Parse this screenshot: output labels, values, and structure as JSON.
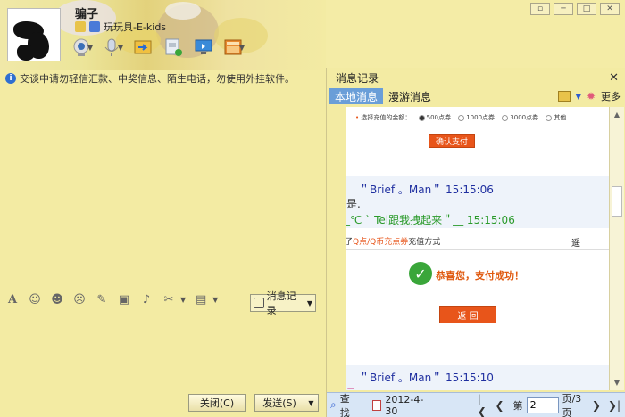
{
  "header": {
    "nickname": "骗子",
    "status_text": "玩玩具-E-kids"
  },
  "notice": "交谈中请勿轻信汇款、中奖信息、陌生电话，勿使用外挂软件。",
  "input": {
    "history_button_label": "消息记录",
    "close_button_label": "关闭(C)",
    "send_button_label": "发送(S)"
  },
  "history_panel": {
    "title": "消息记录",
    "tabs": [
      {
        "label": "本地消息",
        "active": true
      },
      {
        "label": "漫游消息",
        "active": false
      }
    ],
    "more_label": "更多",
    "messages": [
      {
        "header": "＂Brief 。Man＂ 15:15:06",
        "text": "是."
      },
      {
        "header": "__℃ ` Tel跟我拽起来＂__ 15:15:06",
        "text": ""
      },
      {
        "header": "＂Brief 。Man＂ 15:15:10",
        "text": "="
      }
    ],
    "payment_snippet": {
      "label": "选择充值的金额：",
      "options": [
        "500点券",
        "1000点券",
        "3000点券",
        "其他"
      ],
      "confirm_label": "确认支付"
    },
    "success_snippet": {
      "topline_prefix": "了",
      "topline_link": "Q点/Q币充点券",
      "topline_suffix": "充值方式",
      "topline_right": "遥",
      "message": "恭喜您，支付成功！",
      "return_label": "返 回"
    },
    "bottom": {
      "search_label": "查找",
      "date": "2012-4-30",
      "page_prefix": "第",
      "page_value": "2",
      "page_suffix": "页/3页"
    }
  },
  "colors": {
    "accent_blue": "#6a9ed8",
    "orange_button": "#e8551a",
    "green_check": "#3aa63a",
    "nick_blue": "#1f2fa0",
    "nick_green": "#2a9a2a"
  }
}
